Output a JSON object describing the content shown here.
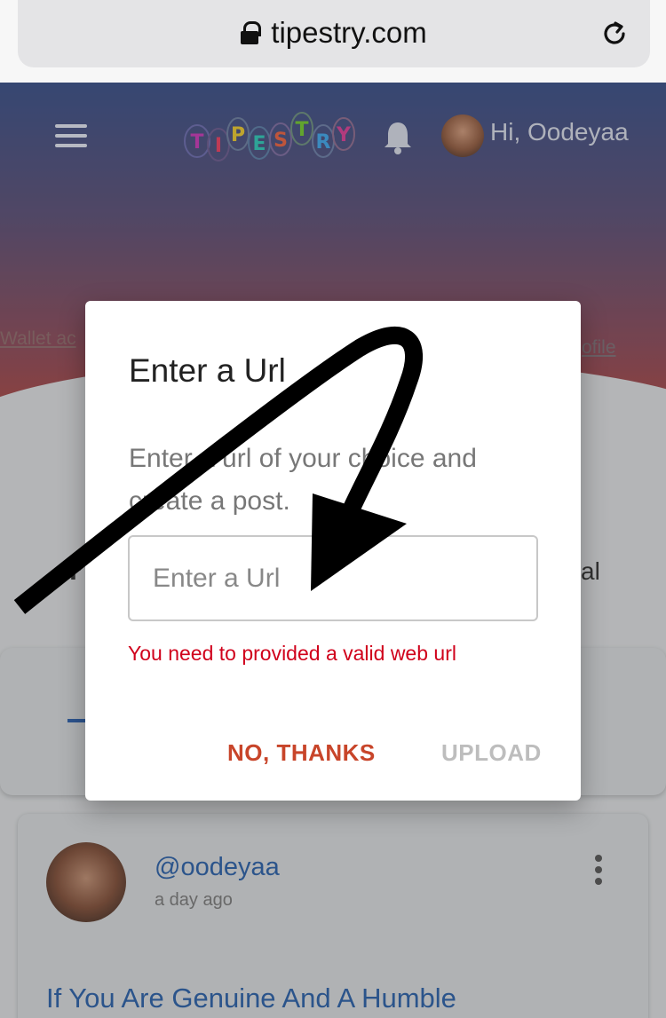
{
  "browser": {
    "url": "tipestry.com"
  },
  "header": {
    "logo_letters": [
      "T",
      "I",
      "P",
      "E",
      "S",
      "T",
      "R",
      "Y"
    ],
    "greeting": "Hi, Oodeyaa"
  },
  "background": {
    "left_link": "Wallet ac",
    "right_link": "ofile",
    "left_letter": "r",
    "right_letter": "al"
  },
  "post": {
    "username": "@oodeyaa",
    "time": "a day ago",
    "title": "If You Are Genuine And A Humble"
  },
  "dialog": {
    "title": "Enter a Url",
    "description": "Enter a url of your choice and create a post.",
    "input_placeholder": "Enter a Url",
    "input_value": "",
    "error": "You need to provided a valid web url",
    "cancel_label": "NO, THANKS",
    "upload_label": "UPLOAD"
  },
  "colors": {
    "error": "#d0011b",
    "cancel": "#c8452a",
    "disabled": "#bdbdbd",
    "link": "#2d5fa2"
  }
}
